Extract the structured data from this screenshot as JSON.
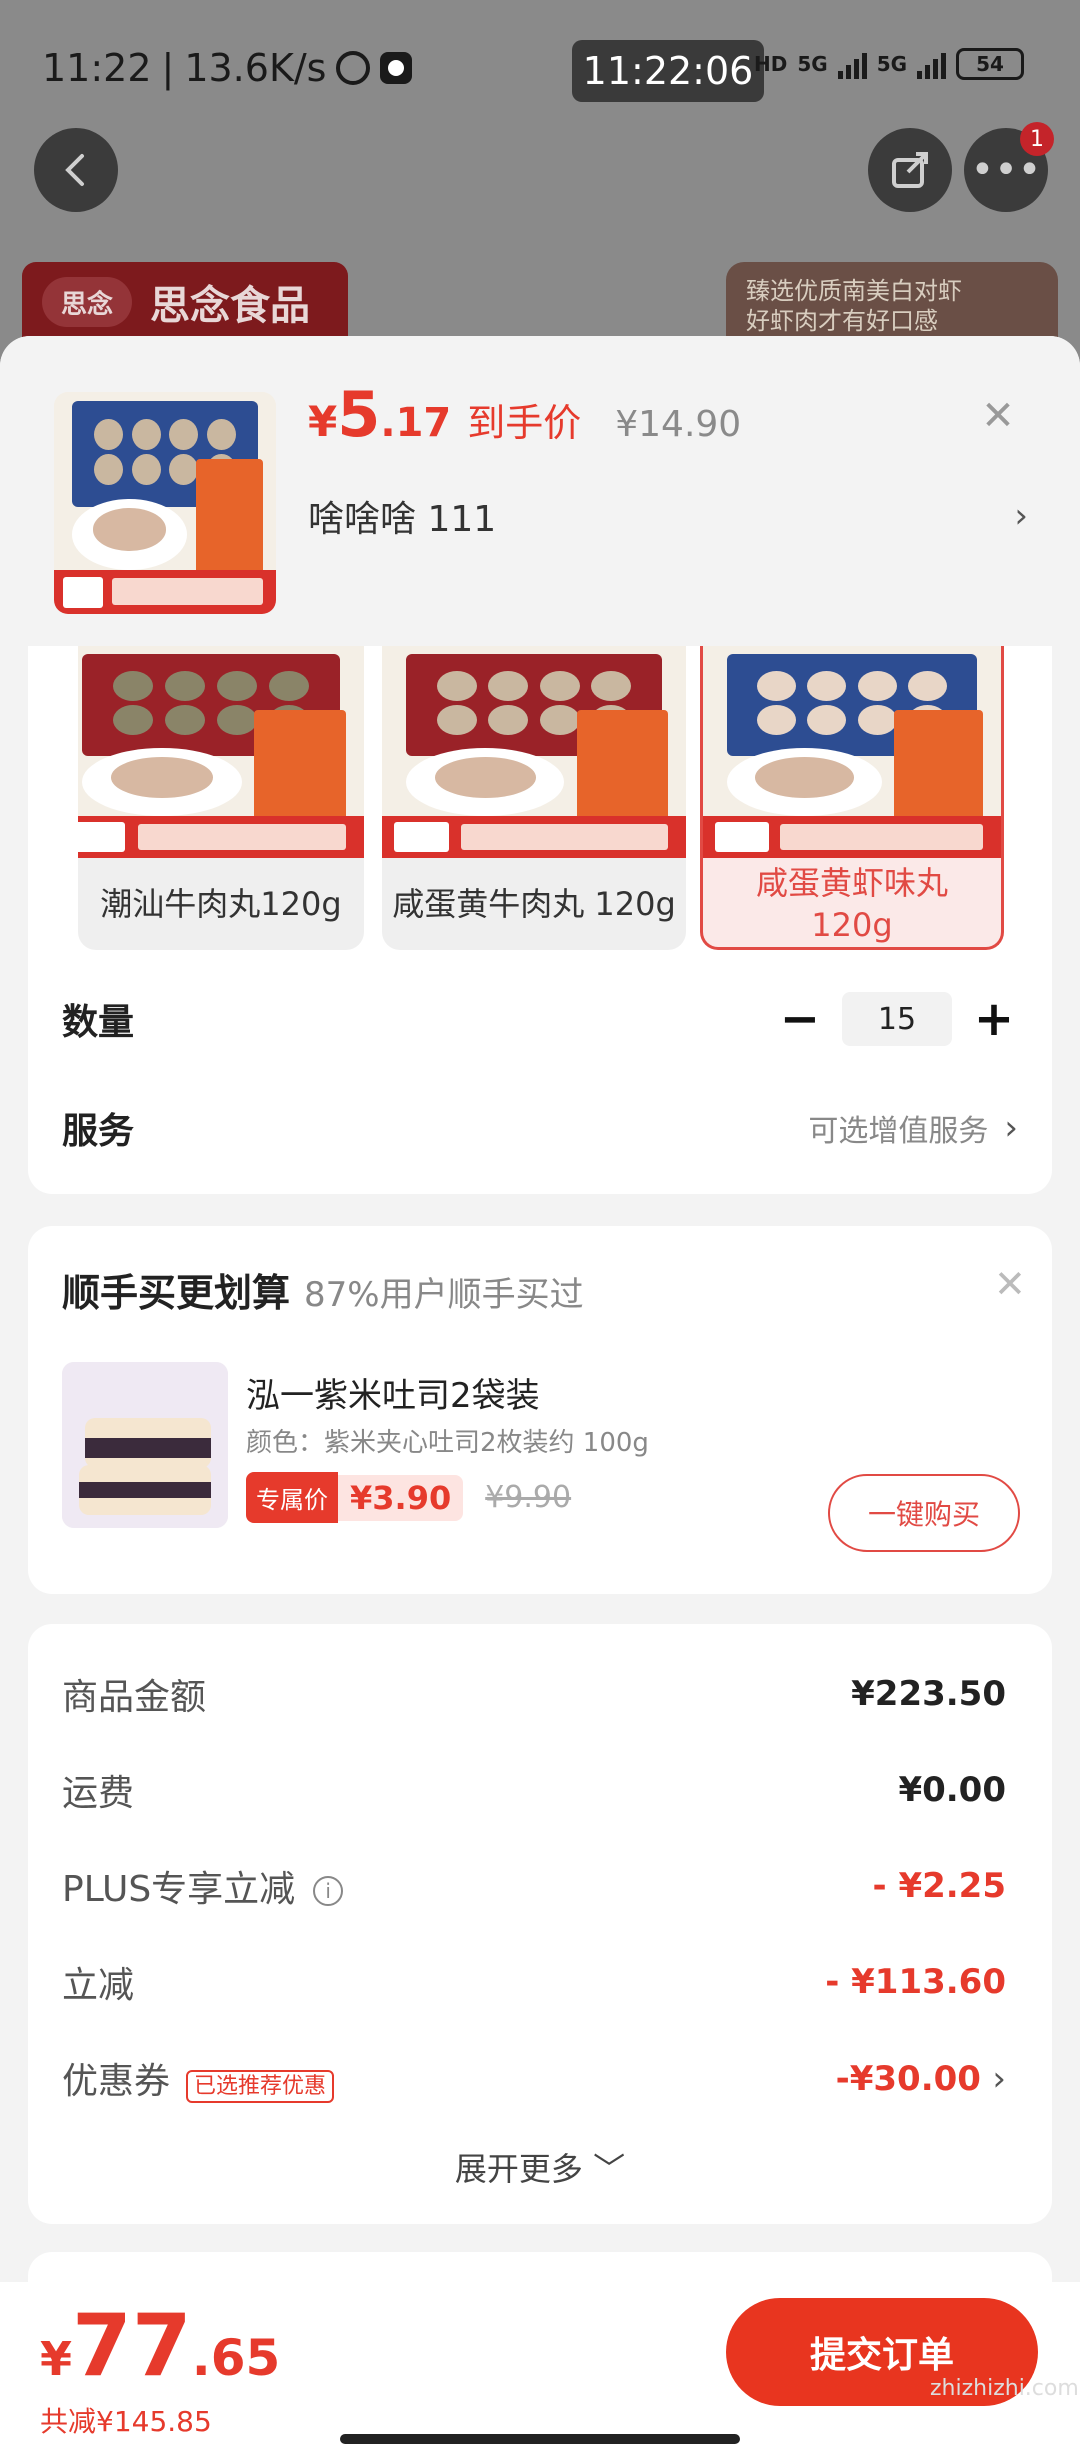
{
  "statusbar": {
    "time": "11:22",
    "speed": "13.6K/s",
    "clock_overlay": "11:22:06",
    "net1": "5G",
    "net2": "5G",
    "battery": "54",
    "hd": "HD"
  },
  "nav": {
    "badge_count": "1"
  },
  "background": {
    "brand_logo": "思念",
    "brand_name": "思念食品",
    "promo_line1": "臻选优质南美白对虾",
    "promo_line2": "好虾肉才有好口感"
  },
  "sheet": {
    "price_yen": "¥",
    "price_int": "5",
    "price_dec": ".17",
    "price_label": "到手价",
    "original_price": "¥14.90",
    "selected_spec": "啥啥啥  111"
  },
  "options": [
    {
      "label": "潮汕牛肉丸120g",
      "selected": false
    },
    {
      "label": "咸蛋黄牛肉丸 120g",
      "selected": false
    },
    {
      "label": "咸蛋黄虾味丸 120g",
      "selected": true
    }
  ],
  "quantity": {
    "label": "数量",
    "value": "15",
    "minus": "−",
    "plus": "+"
  },
  "service": {
    "label": "服务",
    "hint": "可选增值服务"
  },
  "addon": {
    "title": "顺手买更划算",
    "subtitle": "87%用户顺手买过",
    "item_name": "泓一紫米吐司2袋装",
    "item_spec": "颜色：紫米夹心吐司2枚装约 100g",
    "tag": "专属价",
    "price": "¥3.90",
    "old_price": "¥9.90",
    "button": "一键购买"
  },
  "summary": {
    "rows": [
      {
        "label": "商品金额",
        "value": "¥223.50",
        "red": false
      },
      {
        "label": "运费",
        "value": "¥0.00",
        "red": false
      },
      {
        "label": "PLUS专享立减",
        "value": "- ¥2.25",
        "red": true
      },
      {
        "label": "立减",
        "value": "- ¥113.60",
        "red": true
      },
      {
        "label": "优惠券",
        "value": "-¥30.00",
        "red": true,
        "tag": "已选推荐优惠"
      }
    ],
    "expand": "展开更多"
  },
  "bottom": {
    "total_yen": "¥",
    "total_int": "77",
    "total_dec": ".65",
    "saved": "共减¥145.85",
    "submit": "提交订单",
    "watermark": "zhizhizhi.com"
  },
  "colors": {
    "accent": "#e63a2c",
    "submit": "#e8351f",
    "selected_border": "#e14a44"
  }
}
